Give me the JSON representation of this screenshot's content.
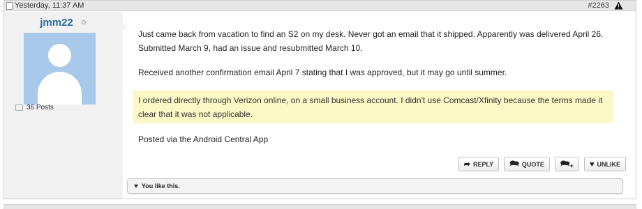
{
  "post": {
    "date": "Yesterday, 11:37 AM",
    "number": "#2263",
    "icons": {
      "document": "document-icon",
      "report": "warning-triangle-icon",
      "status": "offline-status-icon"
    }
  },
  "user": {
    "name": "jmm22",
    "posts": "36 Posts"
  },
  "message": {
    "p1": "Just came back from vacation to find an S2 on my desk. Never got an email that it shipped. Apparently was delivered April 26. Submitted March 9, had an issue and resubmitted March 10.",
    "p2": "Received another confirmation email April 7 stating that I was approved, but it may go until summer.",
    "p3": "I ordered directly through Verizon online, on a small business account. I didn't use Comcast/Xfinity because the terms made it clear that it was not applicable.",
    "p4": "Posted via the Android Central App"
  },
  "actions": {
    "reply": "REPLY",
    "quote": "QUOTE",
    "unlike": "UNLIKE"
  },
  "likes": {
    "text": "You like this."
  },
  "colors": {
    "username": "#2c6aa3",
    "highlight": "#fbf8c6",
    "avatar_bg": "#a8c9ea"
  }
}
